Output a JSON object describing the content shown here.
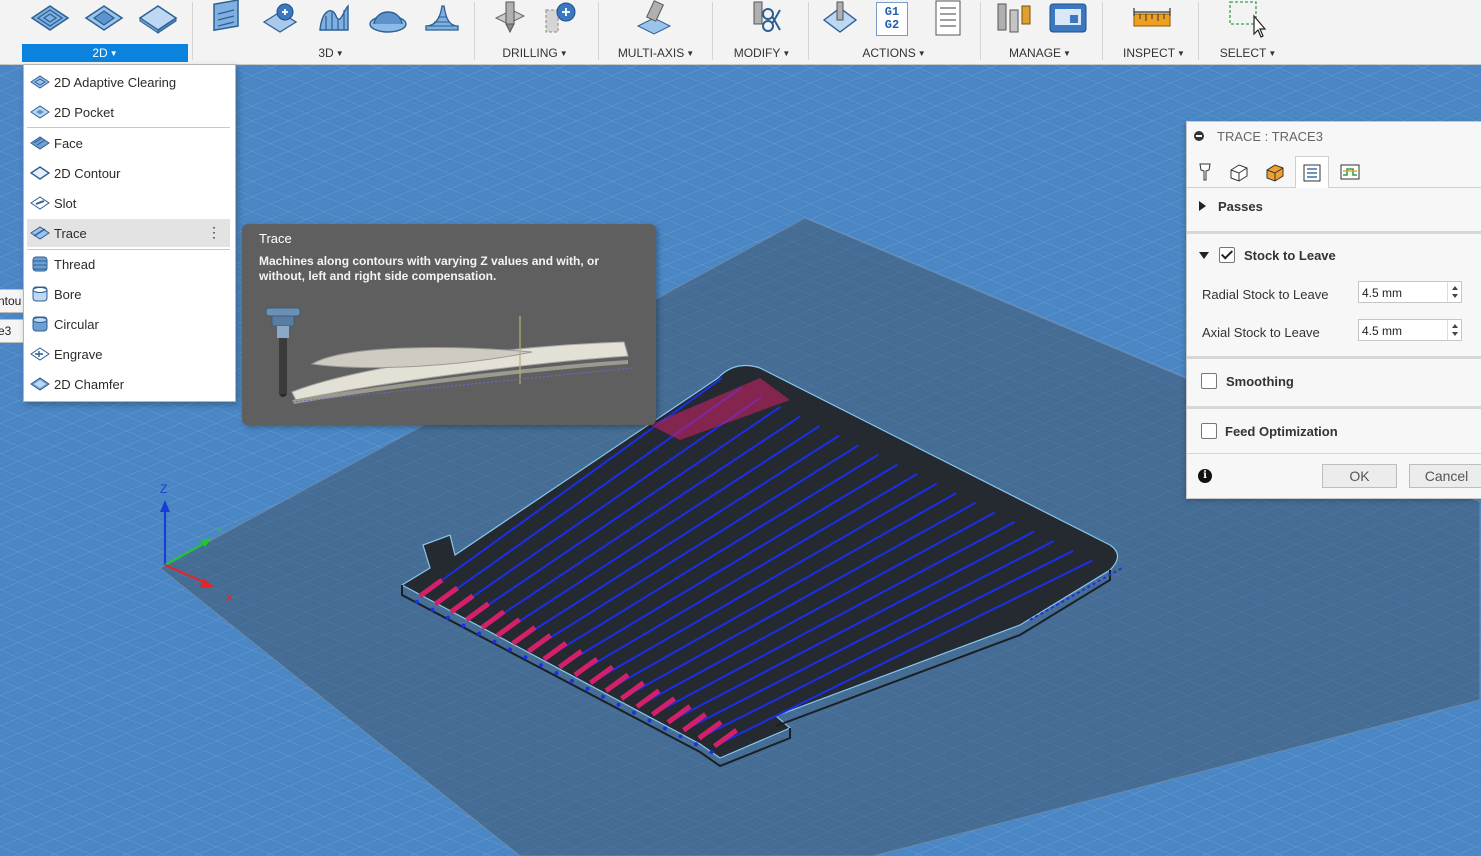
{
  "toolbar": {
    "groups": [
      {
        "label": "2D",
        "active": true
      },
      {
        "label": "3D"
      },
      {
        "label": "DRILLING"
      },
      {
        "label": "MULTI-AXIS"
      },
      {
        "label": "MODIFY"
      },
      {
        "label": "ACTIONS"
      },
      {
        "label": "MANAGE"
      },
      {
        "label": "INSPECT"
      },
      {
        "label": "SELECT"
      }
    ],
    "actions_gcode_icon": "G1\nG2"
  },
  "menu_2d": {
    "items": [
      {
        "label": "2D Adaptive Clearing",
        "icon": "adaptive-clearing-icon"
      },
      {
        "label": "2D Pocket",
        "icon": "pocket-icon"
      },
      {
        "label": "Face",
        "icon": "face-icon"
      },
      {
        "label": "2D Contour",
        "icon": "contour-icon"
      },
      {
        "label": "Slot",
        "icon": "slot-icon"
      },
      {
        "label": "Trace",
        "icon": "trace-icon",
        "hovered": true
      },
      {
        "label": "Thread",
        "icon": "thread-icon"
      },
      {
        "label": "Bore",
        "icon": "bore-icon"
      },
      {
        "label": "Circular",
        "icon": "circular-icon"
      },
      {
        "label": "Engrave",
        "icon": "engrave-icon"
      },
      {
        "label": "2D Chamfer",
        "icon": "chamfer-icon"
      }
    ],
    "more_glyph": "⋮"
  },
  "tooltip": {
    "title": "Trace",
    "description": "Machines along contours with varying Z values and with, or without, left and right side compensation."
  },
  "left_tabs": [
    "ntou",
    "e3"
  ],
  "triad": {
    "z": "Z",
    "y": "Y",
    "x": "X"
  },
  "panel": {
    "title": "TRACE : TRACE3",
    "tabs": [
      "tool-tab-icon",
      "geometry-tab-icon",
      "heights-tab-icon",
      "passes-tab-icon",
      "linking-tab-icon"
    ],
    "active_tab": 3,
    "passes_label": "Passes",
    "stock_to_leave": {
      "label": "Stock to Leave",
      "checked": true
    },
    "radial": {
      "label": "Radial Stock to Leave",
      "value": "4.5 mm"
    },
    "axial": {
      "label": "Axial Stock to Leave",
      "value": "4.5 mm"
    },
    "smoothing": {
      "label": "Smoothing",
      "checked": false
    },
    "feed_optimization": {
      "label": "Feed Optimization",
      "checked": false
    },
    "ok_label": "OK",
    "cancel_label": "Cancel",
    "info_glyph": "i"
  },
  "colors": {
    "toolbar_bg": "#f3f3f3",
    "accent": "#0b82dd",
    "viewport_bg": "#4a86c4",
    "toolpath": "#1b2fe6",
    "lead": "#d4206a",
    "tooltip_bg": "#5f5f5f"
  }
}
